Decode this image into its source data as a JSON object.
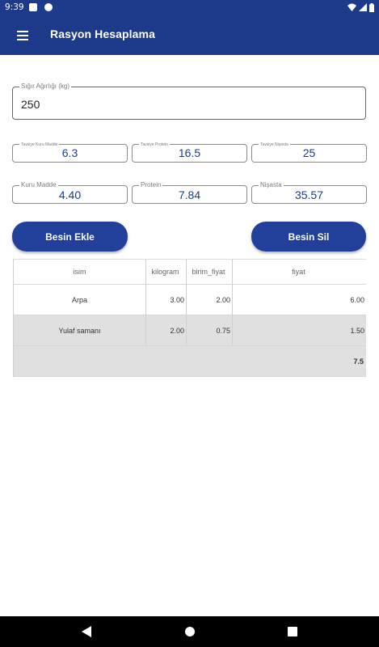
{
  "status_bar": {
    "time": "9:39",
    "icons": [
      "notification-a-icon",
      "notification-f-icon",
      "wifi-icon",
      "signal-icon",
      "battery-icon"
    ]
  },
  "app_bar": {
    "title": "Rasyon Hesaplama",
    "menu_icon": "menu-icon"
  },
  "weight_field": {
    "label": "Sığır Ağırlığı (kg)",
    "value": "250"
  },
  "recommended": [
    {
      "label": "Tavsiye Kuru Madde",
      "value": "6.3"
    },
    {
      "label": "Tavsiye Protein",
      "value": "16.5"
    },
    {
      "label": "Tavsiye Nişasta",
      "value": "25"
    }
  ],
  "computed": [
    {
      "label": "Kuru Madde",
      "value": "4.40"
    },
    {
      "label": "Protein",
      "value": "7.84"
    },
    {
      "label": "Nişasta",
      "value": "35.57"
    }
  ],
  "buttons": {
    "add": "Besin Ekle",
    "delete": "Besin Sil"
  },
  "table": {
    "headers": [
      "isim",
      "kilogram",
      "birim_fiyat",
      "fiyat"
    ],
    "rows": [
      [
        "Arpa",
        "3.00",
        "2.00",
        "6.00"
      ],
      [
        "Yulaf  samanı",
        "2.00",
        "0.75",
        "1.50"
      ]
    ],
    "total": "7.5"
  },
  "colors": {
    "primary": "#1d3b8a",
    "button": "#22409a",
    "value_text": "#1d3b8a",
    "row_gray": "#e0e0e0"
  }
}
